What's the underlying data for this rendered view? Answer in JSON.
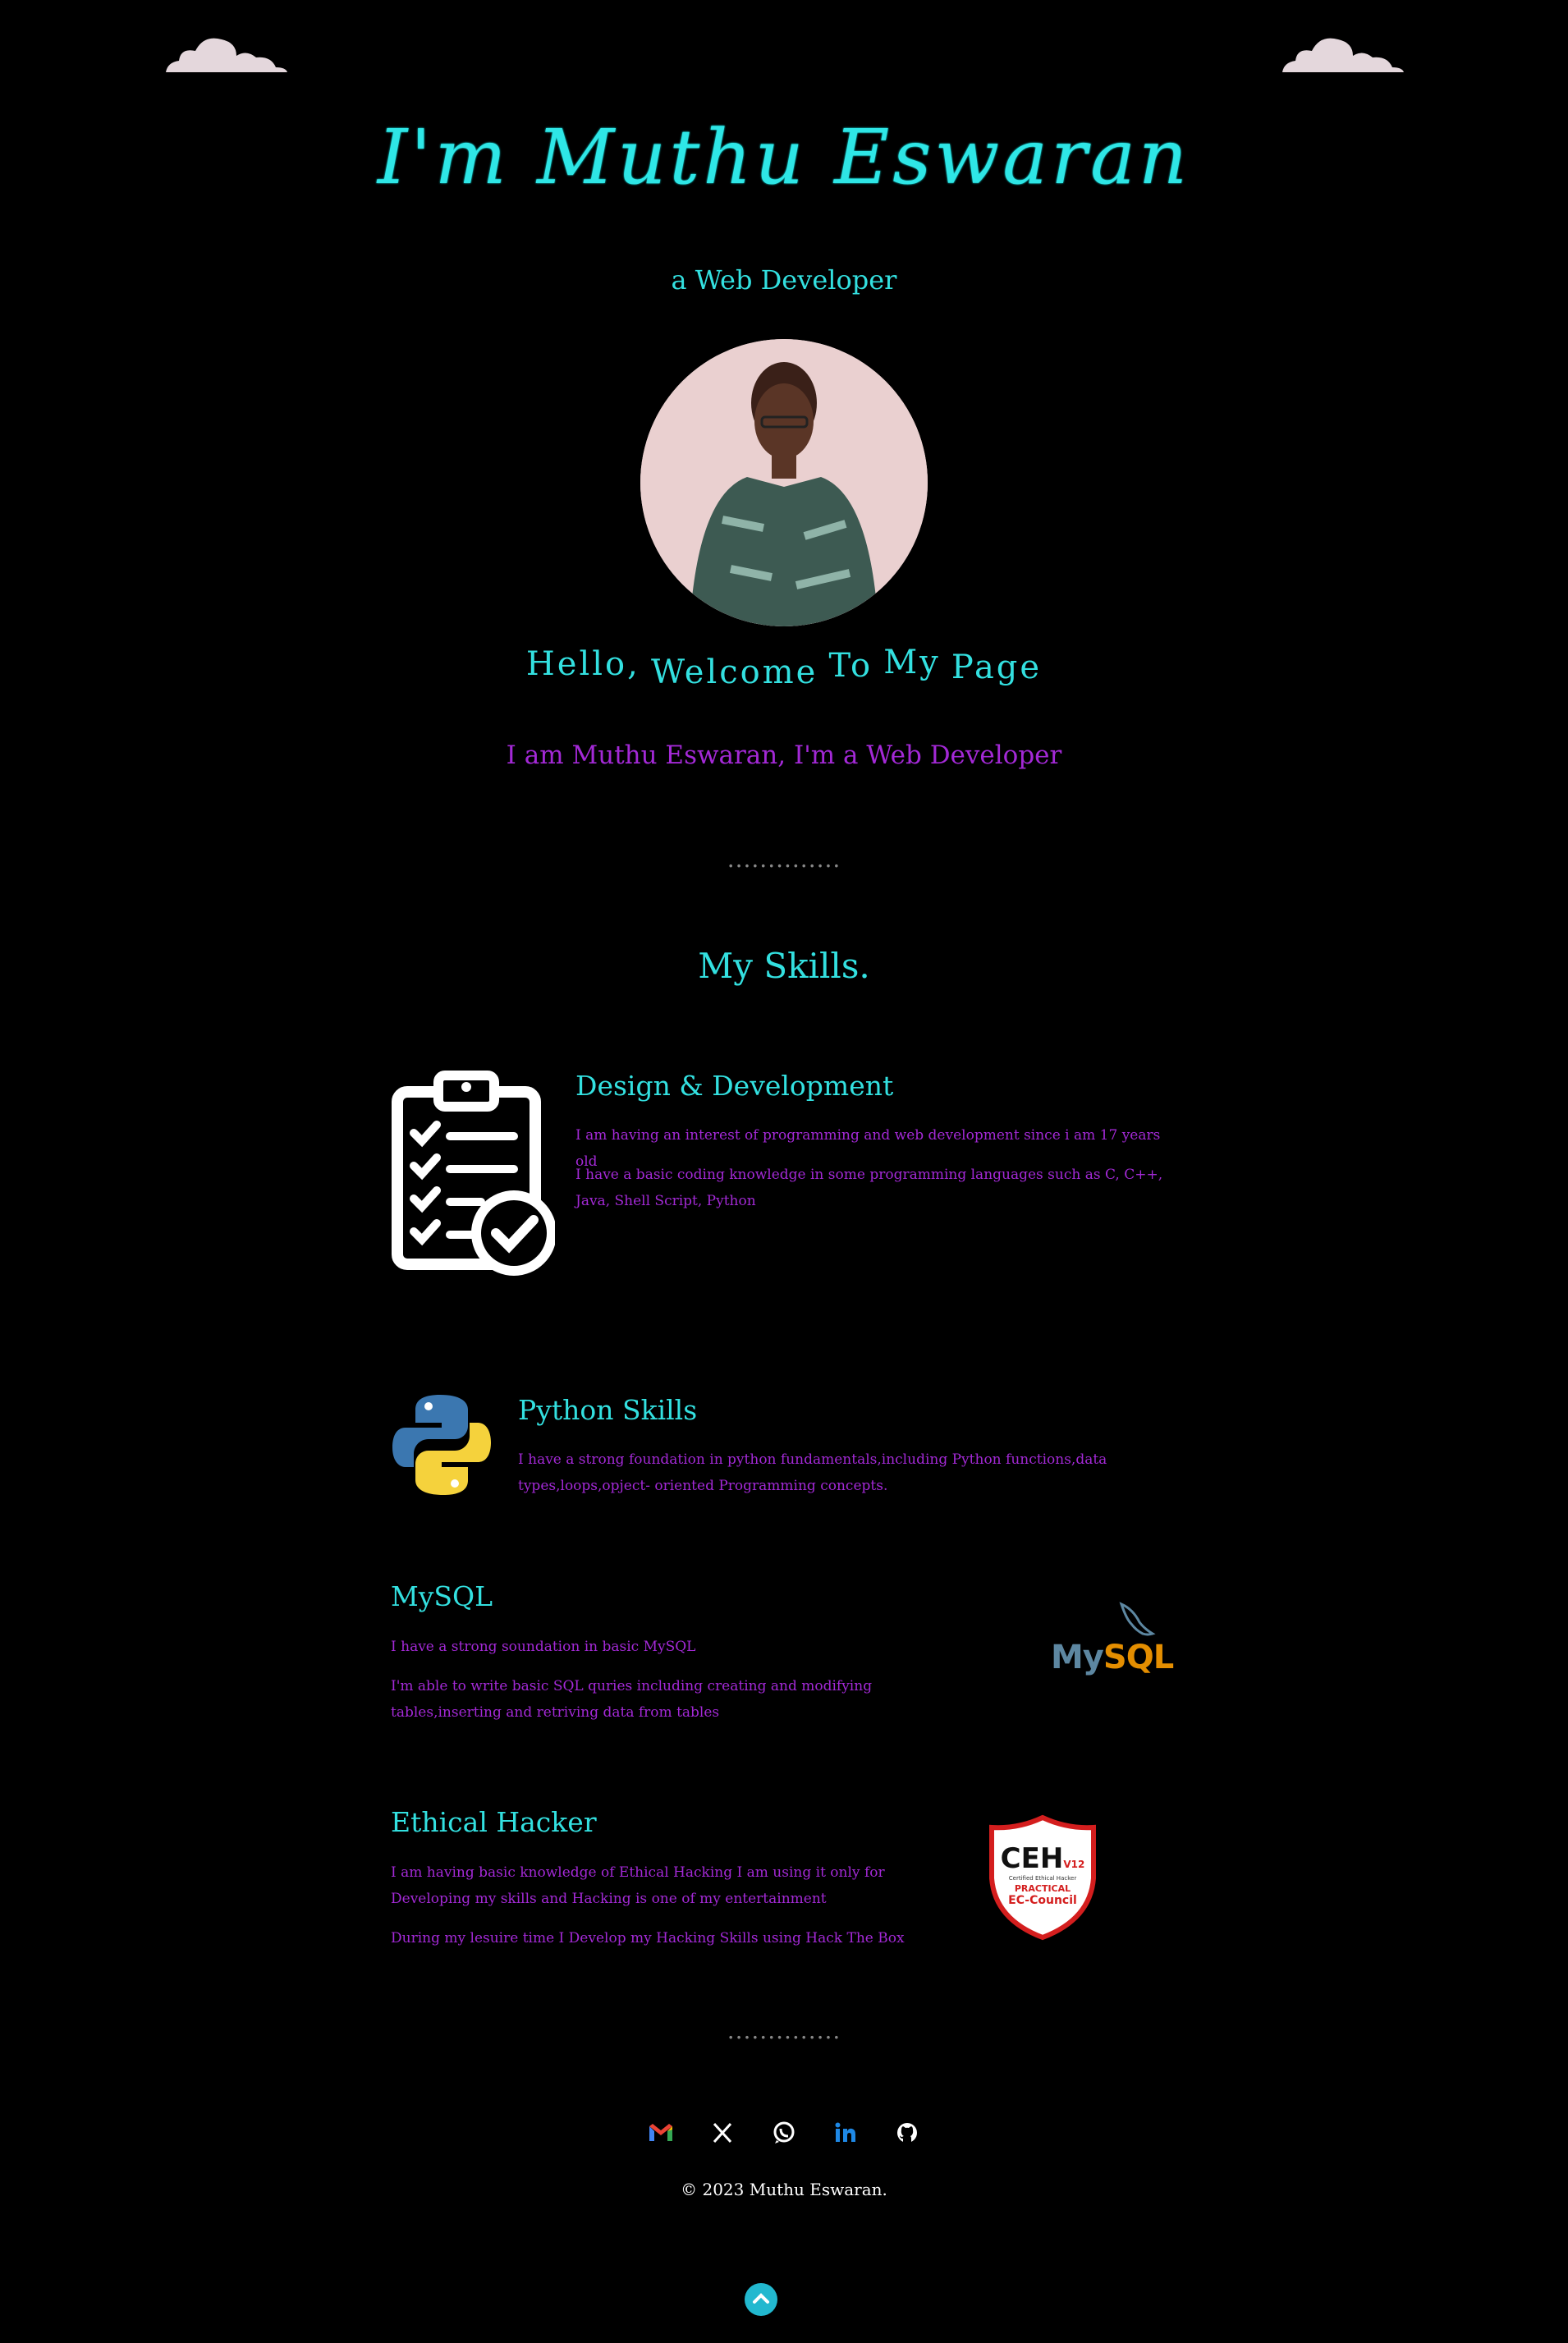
{
  "hero": {
    "title": "I'm Muthu Eswaran",
    "role": "a Web Developer",
    "welcome_words": [
      "Hello,",
      "Welcome",
      "To",
      "My",
      "Page"
    ],
    "intro": "I am Muthu Eswaran, I'm a Web Developer"
  },
  "divider": "..............",
  "skills": {
    "title": "My Skills.",
    "items": [
      {
        "heading": "Design & Development",
        "paragraphs": [
          "I am having an interest of programming and web development since i am 17 years old",
          "I have a basic coding knowledge in some programming languages such as C, C++, Java, Shell Script, Python"
        ],
        "icon": "clipboard-check-icon"
      },
      {
        "heading": "Python Skills",
        "paragraphs": [
          "I have a strong foundation in python fundamentals,including Python functions,data types,loops,opject- oriented Programming concepts."
        ],
        "icon": "python-logo-icon"
      },
      {
        "heading": "MySQL",
        "paragraphs": [
          "I have a strong soundation in basic MySQL",
          "I'm able to write basic SQL quries including creating and modifying tables,inserting and retriving data from tables"
        ],
        "logo_text": "MySQL",
        "icon": "mysql-logo-icon"
      },
      {
        "heading": "Ethical Hacker",
        "paragraphs": [
          "I am having basic knowledge of Ethical Hacking I am using it only for Developing my skills and Hacking is one of my entertainment",
          "During my lesuire time I Develop my Hacking Skills using Hack The Box"
        ],
        "badge": {
          "main": "CEH",
          "version": "V12",
          "line1": "PRACTICAL",
          "line2": "EC-Council",
          "sub": "Certified Ethical Hacker"
        },
        "icon": "ceh-badge-icon"
      }
    ]
  },
  "footer": {
    "socials": [
      "gmail-icon",
      "x-icon",
      "whatsapp-icon",
      "linkedin-icon",
      "github-icon"
    ],
    "copyright": "© 2023 Muthu Eswaran."
  },
  "colors": {
    "background": "#000000",
    "accent_cyan": "#33e0e0",
    "accent_purple": "#a329d6",
    "cloud": "#e4d7dc"
  }
}
